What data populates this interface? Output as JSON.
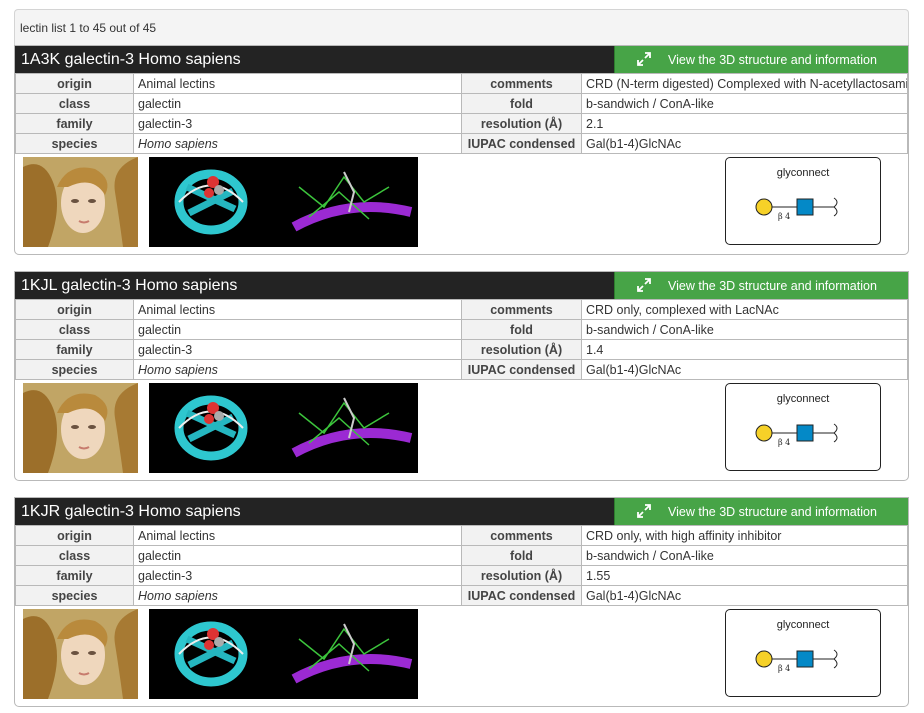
{
  "list_header": "lectin list 1 to 45 out of 45",
  "view_label": "View the 3D structure and information",
  "glyco_label": "glyconnect",
  "glycan_linkage": "β 4",
  "field_labels": {
    "origin": "origin",
    "class": "class",
    "family": "family",
    "species": "species",
    "comments": "comments",
    "fold": "fold",
    "resolution": "resolution (Å)",
    "iupac": "IUPAC condensed"
  },
  "colors": {
    "header_bg": "#232323",
    "button_green": "#47a447",
    "galactose": "#f6d128",
    "glcnac": "#0489c7"
  },
  "entries": [
    {
      "title": "1A3K galectin-3 Homo sapiens",
      "origin": "Animal lectins",
      "class": "galectin",
      "family": "galectin-3",
      "species": "Homo sapiens",
      "comments": "CRD (N-term digested) Complexed with N-acetyllactosamine",
      "fold": "b-sandwich / ConA-like",
      "resolution": "2.1",
      "iupac": "Gal(b1-4)GlcNAc"
    },
    {
      "title": "1KJL galectin-3 Homo sapiens",
      "origin": "Animal lectins",
      "class": "galectin",
      "family": "galectin-3",
      "species": "Homo sapiens",
      "comments": "CRD only, complexed with LacNAc",
      "fold": "b-sandwich / ConA-like",
      "resolution": "1.4",
      "iupac": "Gal(b1-4)GlcNAc"
    },
    {
      "title": "1KJR galectin-3 Homo sapiens",
      "origin": "Animal lectins",
      "class": "galectin",
      "family": "galectin-3",
      "species": "Homo sapiens",
      "comments": "CRD only, with high affinity inhibitor",
      "fold": "b-sandwich / ConA-like",
      "resolution": "1.55",
      "iupac": "Gal(b1-4)GlcNAc"
    }
  ]
}
